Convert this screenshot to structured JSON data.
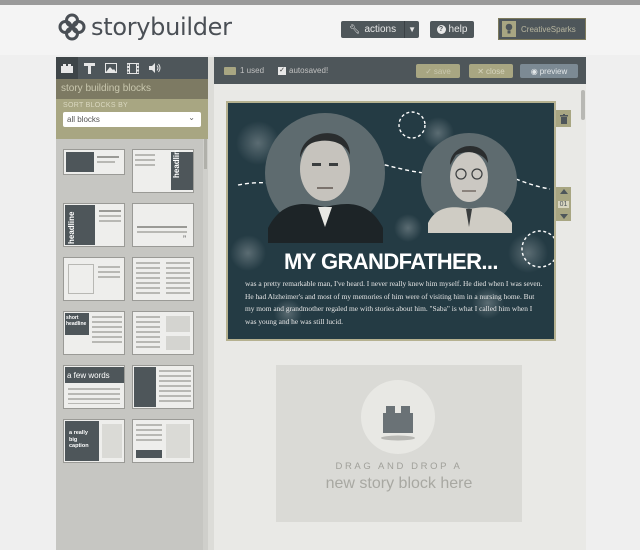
{
  "header": {
    "logo_text": "storybuilder",
    "actions_label": "actions",
    "help_label": "help",
    "user_name": "CreativeSparks"
  },
  "sidebar": {
    "tabs": [
      "blocks-icon",
      "text-icon",
      "image-icon",
      "video-icon",
      "audio-icon"
    ],
    "title": "story building blocks",
    "sort_label": "SORT BLOCKS BY",
    "sort_value": "all blocks",
    "thumbs": [
      {
        "kind": "headline-strip",
        "text": ""
      },
      {
        "kind": "headline-right",
        "text": "headline"
      },
      {
        "kind": "headline-left",
        "text": "headline"
      },
      {
        "kind": "quote",
        "text": ""
      },
      {
        "kind": "article",
        "text": ""
      },
      {
        "kind": "two-column",
        "text": ""
      },
      {
        "kind": "short-headline",
        "text": "short headline"
      },
      {
        "kind": "collage",
        "text": ""
      },
      {
        "kind": "few-words",
        "text": "a few words"
      },
      {
        "kind": "intro-right",
        "text": ""
      },
      {
        "kind": "caption",
        "text": "a really big caption"
      },
      {
        "kind": "grid",
        "text": ""
      }
    ]
  },
  "toolbar": {
    "used_text": "1 used",
    "autosave_text": "autosaved!",
    "save_label": "save",
    "close_label": "close",
    "preview_label": "preview"
  },
  "story": {
    "title": "MY GRANDFATHER...",
    "body": "was a pretty remarkable man, I've heard. I never really knew him myself. He died when I was seven. He had Alzheimer's and most of my memories of him were of visiting him in a nursing home. But my mom and grandmother regaled me with stories about him. \"Saba\" is what I called him when I was young and he was still lucid.",
    "block_number": "01"
  },
  "dropzone": {
    "line1": "DRAG AND DROP A",
    "line2": "new story block here"
  },
  "colors": {
    "dark": "#4e565a",
    "khaki": "#a8a682",
    "story_bg": "#243b44"
  }
}
